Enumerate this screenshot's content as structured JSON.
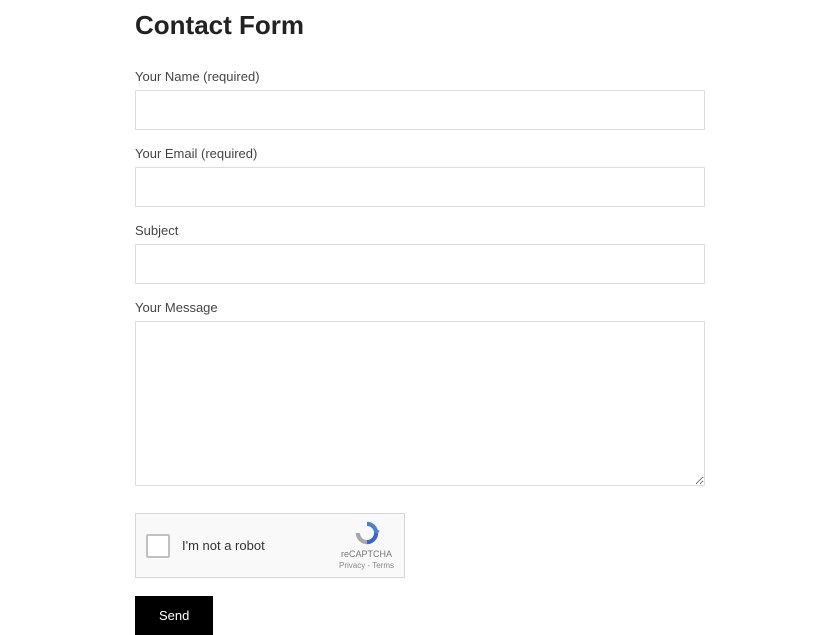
{
  "title": "Contact Form",
  "fields": {
    "name": {
      "label": "Your Name (required)",
      "value": ""
    },
    "email": {
      "label": "Your Email (required)",
      "value": ""
    },
    "subject": {
      "label": "Subject",
      "value": ""
    },
    "message": {
      "label": "Your Message",
      "value": ""
    }
  },
  "recaptcha": {
    "label": "I'm not a robot",
    "brand": "reCAPTCHA",
    "links": "Privacy - Terms"
  },
  "submit": {
    "label": "Send"
  }
}
